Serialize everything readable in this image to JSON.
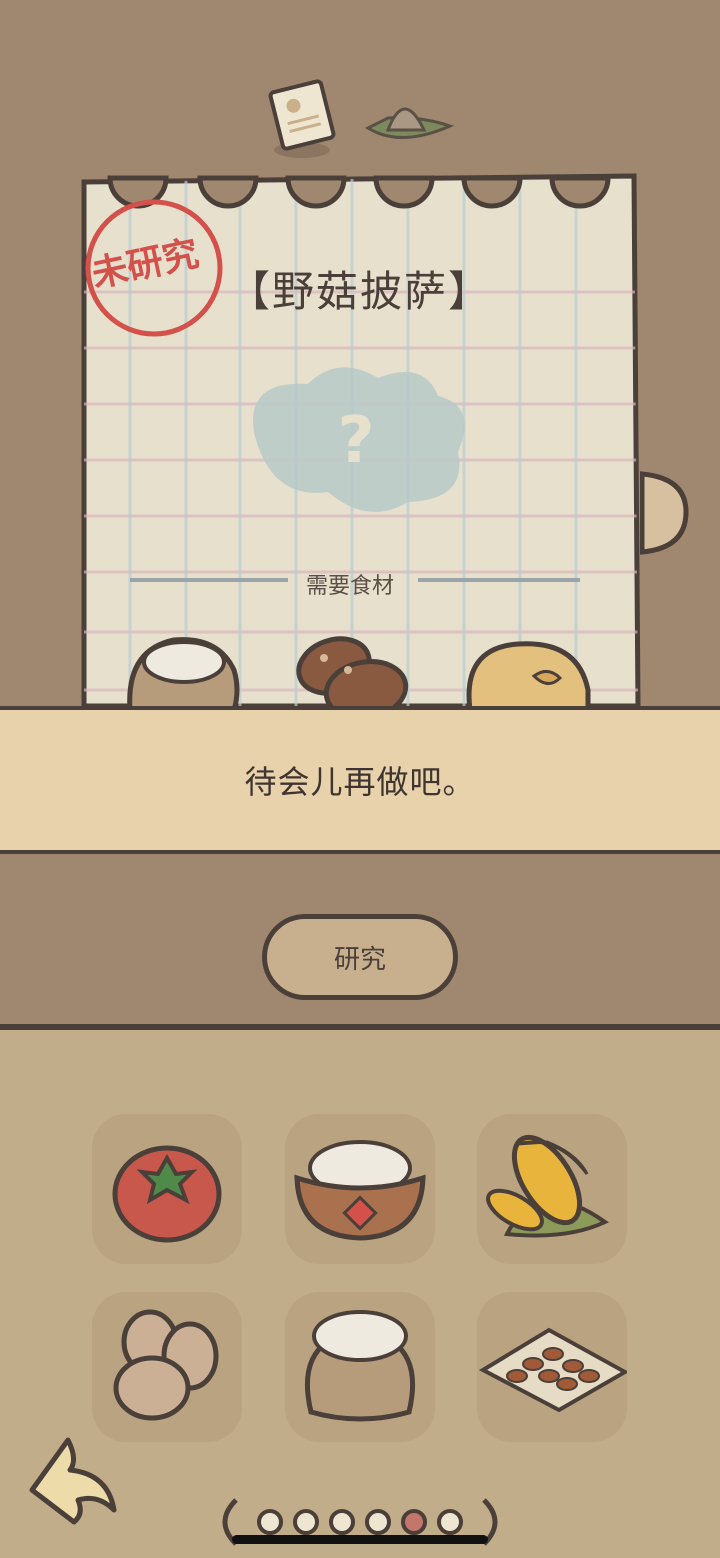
{
  "stamp": {
    "text": "未研究"
  },
  "recipe": {
    "title": "【野菇披萨】",
    "unknown_mark": "?"
  },
  "ingredients_section": {
    "label": "需要食材"
  },
  "message": {
    "text": "待会儿再做吧。"
  },
  "research_button": {
    "label": "研究"
  },
  "inventory": {
    "items": [
      {
        "name": "tomato-icon"
      },
      {
        "name": "rice-bowl-icon"
      },
      {
        "name": "corn-icon"
      },
      {
        "name": "eggs-icon"
      },
      {
        "name": "flour-sack-icon"
      },
      {
        "name": "beans-icon"
      }
    ]
  },
  "pager": {
    "total": 6,
    "current": 5
  },
  "colors": {
    "background": "#a08870",
    "paper": "#e6e0cc",
    "banner": "#e8d2ac",
    "shelf": "#c2ad8a",
    "stamp": "#d4504a",
    "outline": "#4a3f39",
    "active_dot": "#c2776a"
  }
}
